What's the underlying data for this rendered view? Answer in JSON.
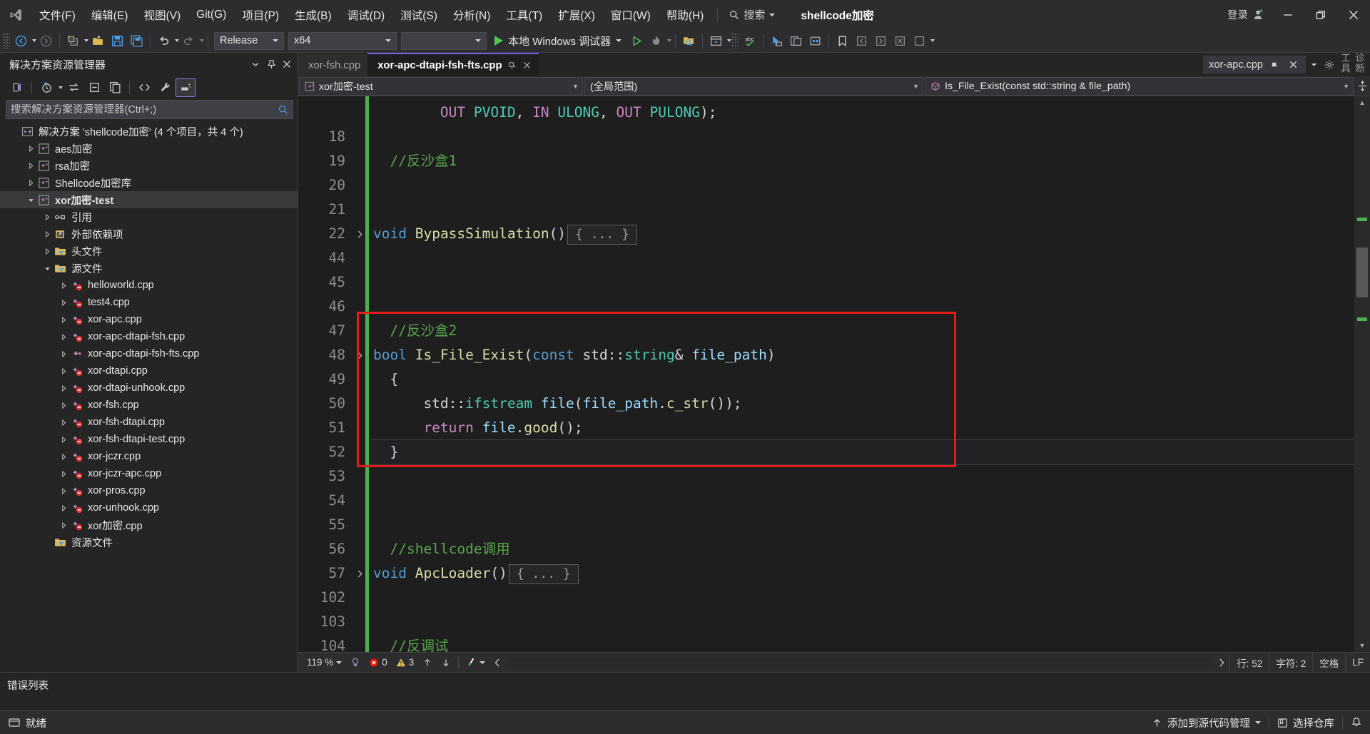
{
  "titlebar": {
    "logo_icon": "visual-studio-logo",
    "menus": [
      {
        "label": "文件(F)",
        "accel": "F"
      },
      {
        "label": "编辑(E)",
        "accel": "E"
      },
      {
        "label": "视图(V)",
        "accel": "V"
      },
      {
        "label": "Git(G)",
        "accel": "G"
      },
      {
        "label": "项目(P)",
        "accel": "P"
      },
      {
        "label": "生成(B)",
        "accel": "B"
      },
      {
        "label": "调试(D)",
        "accel": "D"
      },
      {
        "label": "测试(S)",
        "accel": "S"
      },
      {
        "label": "分析(N)",
        "accel": "N"
      },
      {
        "label": "工具(T)",
        "accel": "T"
      },
      {
        "label": "扩展(X)",
        "accel": "X"
      },
      {
        "label": "窗口(W)",
        "accel": "W"
      },
      {
        "label": "帮助(H)",
        "accel": "H"
      }
    ],
    "search_label": "搜索",
    "solution_name": "shellcode加密",
    "signin_label": "登录",
    "window_buttons": [
      "minimize-button",
      "restore-button",
      "close-button"
    ]
  },
  "toolbar": {
    "configuration": "Release",
    "platform": "x64",
    "empty_combo": "",
    "debug_target": "本地 Windows 调试器",
    "icons": [
      "navigate-back-icon",
      "navigate-forward-icon",
      "new-project-icon",
      "open-file-icon",
      "save-icon",
      "save-all-icon",
      "undo-icon",
      "redo-icon"
    ]
  },
  "solution_explorer": {
    "title": "解决方案资源管理器",
    "search_placeholder": "搜索解决方案资源管理器(Ctrl+;)",
    "toolbar_icons": [
      "vs-home-icon",
      "pending-changes-icon",
      "sync-with-active-icon",
      "collapse-all-icon",
      "show-all-files-icon",
      "code-view-icon",
      "properties-icon",
      "preview-selected-icon"
    ],
    "tree": [
      {
        "label": "解决方案 'shellcode加密' (4 个项目，共 4 个)",
        "indent": 0,
        "chevron": "none",
        "icon": "solution-icon",
        "bold": false,
        "selected": false
      },
      {
        "label": "aes加密",
        "indent": 1,
        "chevron": "collapsed",
        "icon": "cpp-project-icon",
        "bold": false,
        "selected": false
      },
      {
        "label": "rsa加密",
        "indent": 1,
        "chevron": "collapsed",
        "icon": "cpp-project-icon",
        "bold": false,
        "selected": false
      },
      {
        "label": "Shellcode加密库",
        "indent": 1,
        "chevron": "collapsed",
        "icon": "cpp-project-icon",
        "bold": false,
        "selected": false
      },
      {
        "label": "xor加密-test",
        "indent": 1,
        "chevron": "expanded",
        "icon": "cpp-project-icon",
        "bold": true,
        "selected": true
      },
      {
        "label": "引用",
        "indent": 2,
        "chevron": "collapsed",
        "icon": "references-icon",
        "bold": false,
        "selected": false
      },
      {
        "label": "外部依赖项",
        "indent": 2,
        "chevron": "collapsed",
        "icon": "external-deps-icon",
        "bold": false,
        "selected": false
      },
      {
        "label": "头文件",
        "indent": 2,
        "chevron": "collapsed",
        "icon": "filter-folder-icon",
        "bold": false,
        "selected": false
      },
      {
        "label": "源文件",
        "indent": 2,
        "chevron": "expanded",
        "icon": "filter-folder-icon",
        "bold": false,
        "selected": false
      },
      {
        "label": "helloworld.cpp",
        "indent": 3,
        "chevron": "collapsed",
        "icon": "cpp-file-excluded-icon",
        "bold": false,
        "selected": false
      },
      {
        "label": "test4.cpp",
        "indent": 3,
        "chevron": "collapsed",
        "icon": "cpp-file-excluded-icon",
        "bold": false,
        "selected": false
      },
      {
        "label": "xor-apc.cpp",
        "indent": 3,
        "chevron": "collapsed",
        "icon": "cpp-file-excluded-icon",
        "bold": false,
        "selected": false
      },
      {
        "label": "xor-apc-dtapi-fsh.cpp",
        "indent": 3,
        "chevron": "collapsed",
        "icon": "cpp-file-excluded-icon",
        "bold": false,
        "selected": false
      },
      {
        "label": "xor-apc-dtapi-fsh-fts.cpp",
        "indent": 3,
        "chevron": "collapsed",
        "icon": "cpp-file-icon",
        "bold": false,
        "selected": false
      },
      {
        "label": "xor-dtapi.cpp",
        "indent": 3,
        "chevron": "collapsed",
        "icon": "cpp-file-excluded-icon",
        "bold": false,
        "selected": false
      },
      {
        "label": "xor-dtapi-unhook.cpp",
        "indent": 3,
        "chevron": "collapsed",
        "icon": "cpp-file-excluded-icon",
        "bold": false,
        "selected": false
      },
      {
        "label": "xor-fsh.cpp",
        "indent": 3,
        "chevron": "collapsed",
        "icon": "cpp-file-excluded-icon",
        "bold": false,
        "selected": false
      },
      {
        "label": "xor-fsh-dtapi.cpp",
        "indent": 3,
        "chevron": "collapsed",
        "icon": "cpp-file-excluded-icon",
        "bold": false,
        "selected": false
      },
      {
        "label": "xor-fsh-dtapi-test.cpp",
        "indent": 3,
        "chevron": "collapsed",
        "icon": "cpp-file-excluded-icon",
        "bold": false,
        "selected": false
      },
      {
        "label": "xor-jczr.cpp",
        "indent": 3,
        "chevron": "collapsed",
        "icon": "cpp-file-excluded-icon",
        "bold": false,
        "selected": false
      },
      {
        "label": "xor-jczr-apc.cpp",
        "indent": 3,
        "chevron": "collapsed",
        "icon": "cpp-file-excluded-icon",
        "bold": false,
        "selected": false
      },
      {
        "label": "xor-pros.cpp",
        "indent": 3,
        "chevron": "collapsed",
        "icon": "cpp-file-excluded-icon",
        "bold": false,
        "selected": false
      },
      {
        "label": "xor-unhook.cpp",
        "indent": 3,
        "chevron": "collapsed",
        "icon": "cpp-file-excluded-icon",
        "bold": false,
        "selected": false
      },
      {
        "label": "xor加密.cpp",
        "indent": 3,
        "chevron": "collapsed",
        "icon": "cpp-file-excluded-icon",
        "bold": false,
        "selected": false
      },
      {
        "label": "资源文件",
        "indent": 2,
        "chevron": "none",
        "icon": "filter-folder-icon",
        "bold": false,
        "selected": false
      }
    ]
  },
  "editor": {
    "tabs": [
      {
        "label": "xor-fsh.cpp",
        "active": false
      },
      {
        "label": "xor-apc-dtapi-fsh-fts.cpp",
        "active": true
      }
    ],
    "right_dock_tab": "xor-apc.cpp",
    "right_vertical_label": "诊断工具",
    "navbar": {
      "project": "xor加密-test",
      "scope": "(全局范围)",
      "member": "Is_File_Exist(const std::string & file_path)"
    },
    "lines": [
      {
        "num": "",
        "fold": "",
        "html": "<span class=\"pl\">        </span><span class=\"kw2\">OUT</span> <span class=\"ty\">PVOID</span><span class=\"pl\">, </span><span class=\"kw2\">IN</span> <span class=\"ty\">ULONG</span><span class=\"pl\">, </span><span class=\"kw2\">OUT</span> <span class=\"ty\">PULONG</span><span class=\"pl\">);</span>",
        "text": "        OUT PVOID, IN ULONG, OUT PULONG);"
      },
      {
        "num": "18",
        "fold": "",
        "html": "",
        "text": ""
      },
      {
        "num": "19",
        "fold": "",
        "html": "<span class=\"cm\">  //反沙盒1</span>",
        "text": "  //反沙盒1"
      },
      {
        "num": "20",
        "fold": "",
        "html": "",
        "text": ""
      },
      {
        "num": "21",
        "fold": "",
        "html": "",
        "text": ""
      },
      {
        "num": "22",
        "fold": "expanded",
        "html": "<span class=\"kw\">void</span> <span class=\"fn\">BypassSimulation</span><span class=\"pl\">()</span>",
        "text": "void BypassSimulation()",
        "collapsed": "{ ... }"
      },
      {
        "num": "44",
        "fold": "",
        "html": "",
        "text": ""
      },
      {
        "num": "45",
        "fold": "",
        "html": "",
        "text": ""
      },
      {
        "num": "46",
        "fold": "",
        "html": "",
        "text": ""
      },
      {
        "num": "47",
        "fold": "",
        "html": "<span class=\"cm\">  //反沙盒2</span>",
        "text": "  //反沙盒2"
      },
      {
        "num": "48",
        "fold": "expanded",
        "html": "<span class=\"kw\">bool</span> <span class=\"fn\">Is_File_Exist</span><span class=\"pl\">(</span><span class=\"kw\">const</span> <span class=\"pl\">std::</span><span class=\"ty\">string</span><span class=\"pl\">&amp; </span><span class=\"id\">file_path</span><span class=\"pl\">)</span>",
        "text": "bool Is_File_Exist(const std::string& file_path)"
      },
      {
        "num": "49",
        "fold": "",
        "html": "<span class=\"pl\">  {</span>",
        "text": "  {"
      },
      {
        "num": "50",
        "fold": "",
        "html": "<span class=\"pl\">      std::</span><span class=\"ty\">ifstream</span> <span class=\"id\">file</span><span class=\"pl\">(</span><span class=\"id\">file_path</span><span class=\"pl\">.</span><span class=\"fn\">c_str</span><span class=\"pl\">());</span>",
        "text": "      std::ifstream file(file_path.c_str());"
      },
      {
        "num": "51",
        "fold": "",
        "html": "<span class=\"pl\">      </span><span class=\"kw2\">return</span> <span class=\"id\">file</span><span class=\"pl\">.</span><span class=\"fn\">good</span><span class=\"pl\">();</span>",
        "text": "      return file.good();"
      },
      {
        "num": "52",
        "fold": "",
        "html": "<span class=\"pl\">  }</span>",
        "text": "  }",
        "current": true
      },
      {
        "num": "53",
        "fold": "",
        "html": "",
        "text": ""
      },
      {
        "num": "54",
        "fold": "",
        "html": "",
        "text": ""
      },
      {
        "num": "55",
        "fold": "",
        "html": "",
        "text": ""
      },
      {
        "num": "56",
        "fold": "",
        "html": "<span class=\"cm\">  //shellcode调用</span>",
        "text": "  //shellcode调用"
      },
      {
        "num": "57",
        "fold": "expanded",
        "html": "<span class=\"kw\">void</span> <span class=\"fn\">ApcLoader</span><span class=\"pl\">()</span>",
        "text": "void ApcLoader()",
        "collapsed": "{ ... }"
      },
      {
        "num": "102",
        "fold": "",
        "html": "",
        "text": ""
      },
      {
        "num": "103",
        "fold": "",
        "html": "",
        "text": ""
      },
      {
        "num": "104",
        "fold": "",
        "html": "<span class=\"cm\">  //反调试</span>",
        "text": "  //反调试"
      }
    ],
    "annotation": {
      "type": "red-rectangle-highlight",
      "color": "#e21b1b"
    },
    "status": {
      "zoom": "119 %",
      "error_count": "0",
      "warning_count": "3",
      "line_label": "行: 52",
      "column_label": "字符: 2",
      "space_label": "空格",
      "eol_label": "LF"
    }
  },
  "error_list": {
    "title": "错误列表"
  },
  "statusbar": {
    "state": "就绪",
    "source_control_label": "添加到源代码管理",
    "repo_label": "选择仓库",
    "notify_icon": "bell-icon"
  }
}
